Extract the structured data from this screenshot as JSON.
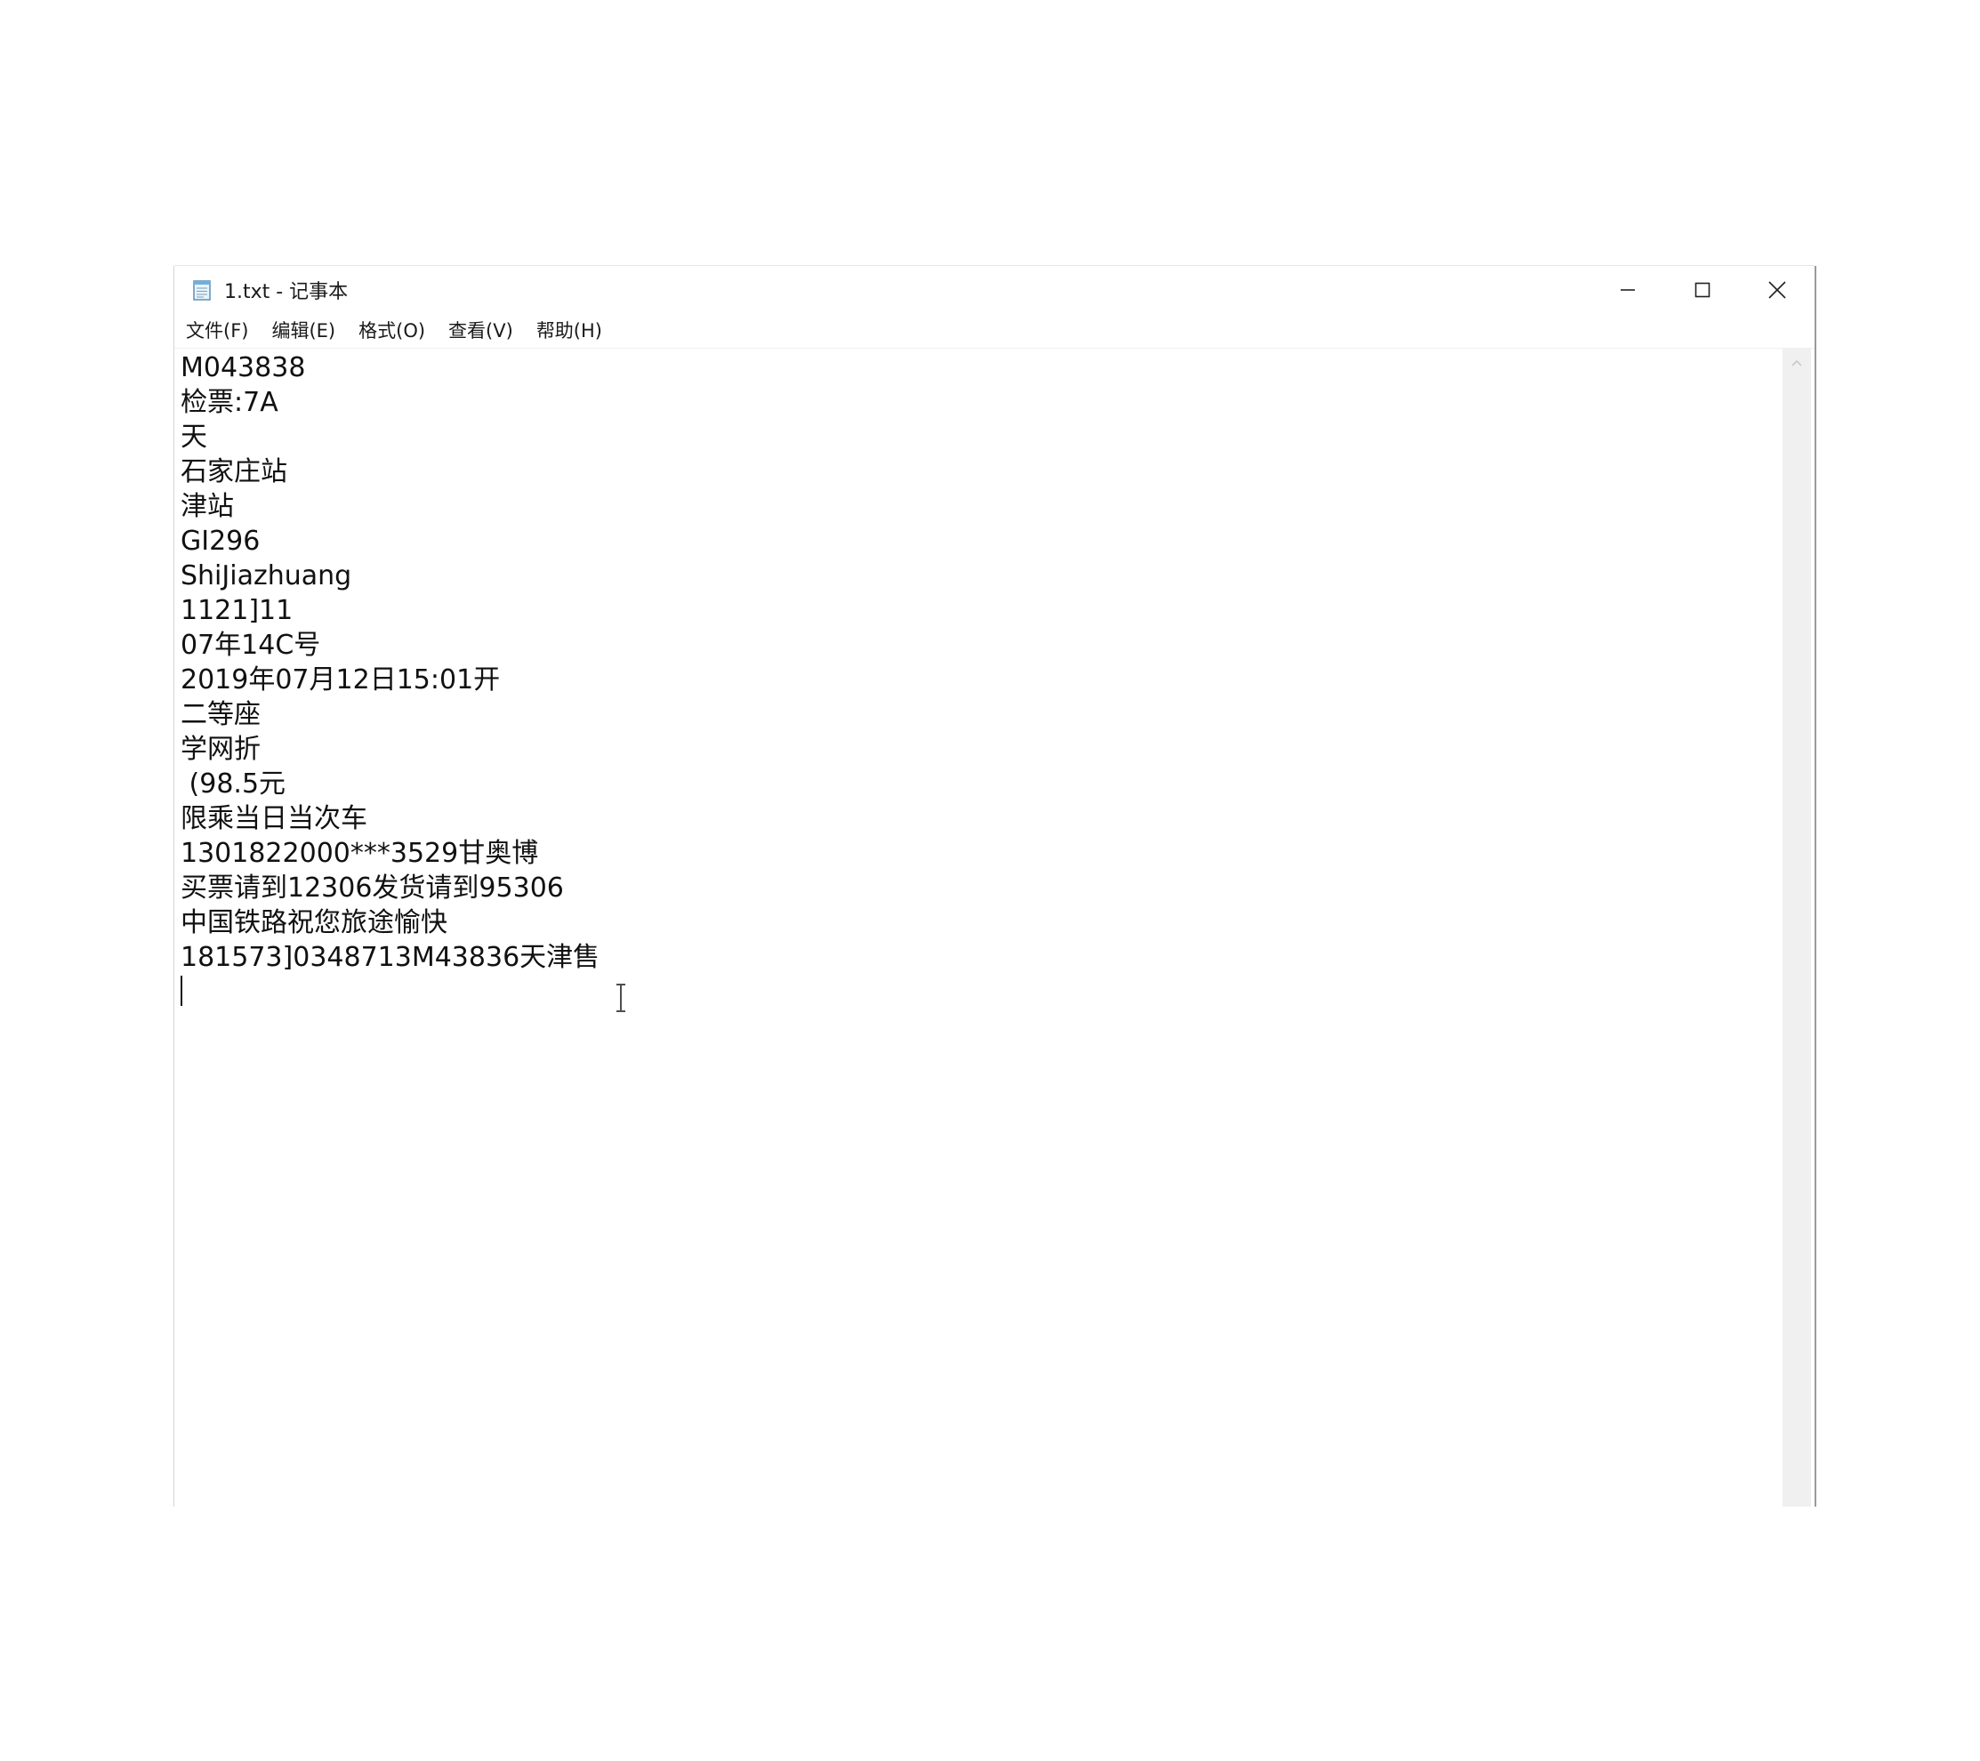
{
  "window": {
    "title": "1.txt - 记事本"
  },
  "menu": {
    "items": [
      "文件(F)",
      "编辑(E)",
      "格式(O)",
      "查看(V)",
      "帮助(H)"
    ]
  },
  "editor": {
    "lines": [
      "M043838",
      "检票:7A",
      "天",
      "石家庄站",
      "津站",
      "GI296",
      "ShiJiazhuang",
      "1121]11",
      "07年14C号",
      "2019年07月12日15:01开",
      "二等座",
      "学网折",
      " (98.5元",
      "限乘当日当次车",
      "1301822000***3529甘奥博",
      "买票请到12306发货请到95306",
      "中国铁路祝您旅途愉快",
      "181573]0348713M43836天津售"
    ]
  },
  "colors": {
    "menu_border": "#f0f0f0",
    "scrollbar": "#f0f0f0",
    "text": "#111111"
  }
}
